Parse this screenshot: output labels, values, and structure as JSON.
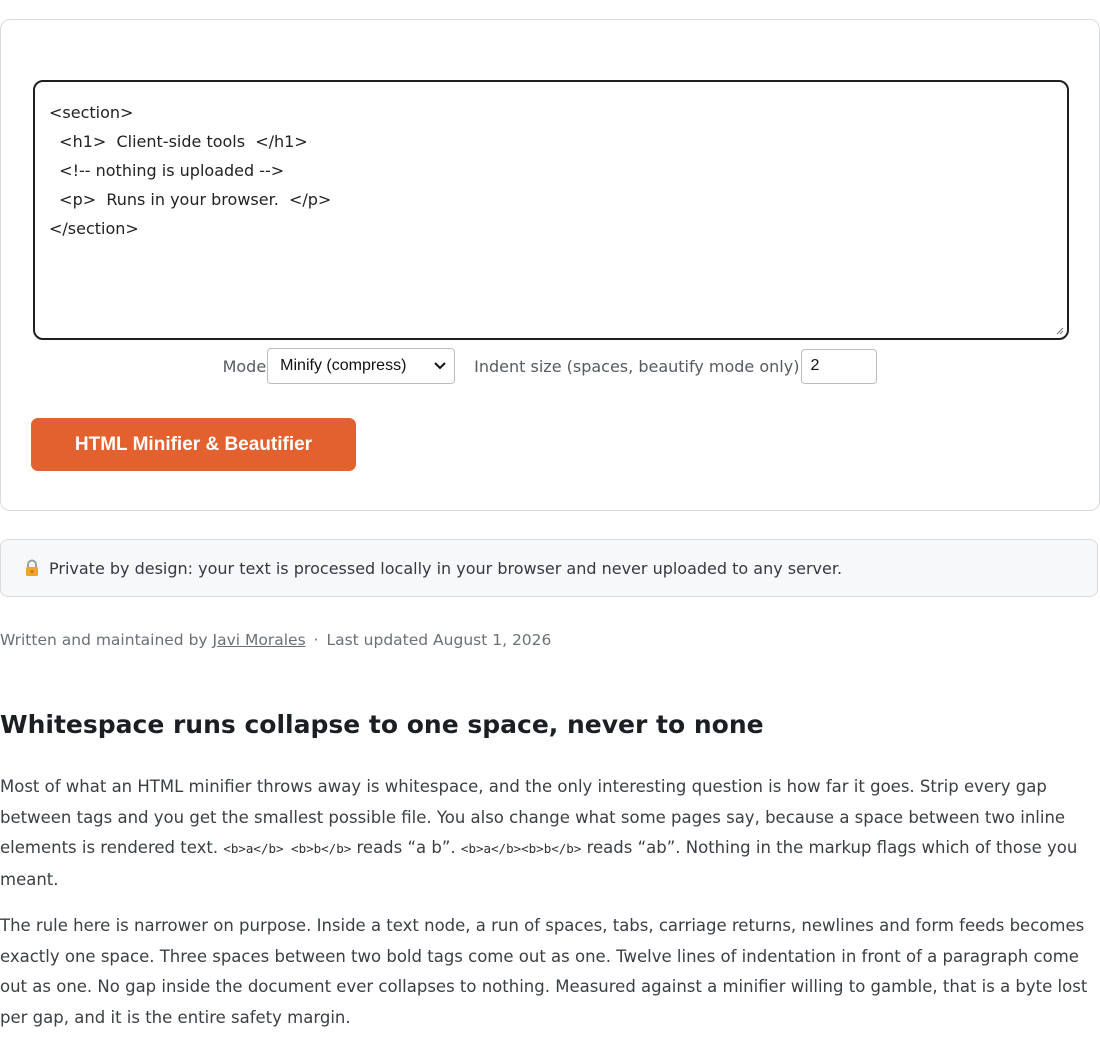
{
  "editor": {
    "lines": [
      "<section>",
      "  <h1>  Client-side tools  </h1>",
      "",
      "  <!-- nothing is uploaded -->",
      "  <p>  Runs in your browser.  </p>",
      "</section>"
    ]
  },
  "controls": {
    "mode_label": "Mode",
    "mode_value": "Minify (compress)",
    "indent_label": "Indent size (spaces, beautify mode only)",
    "indent_value": "2"
  },
  "action_button": "HTML Minifier & Beautifier",
  "notice": {
    "icon": "lock-icon",
    "text": "Private by design: your text is processed locally in your browser and never uploaded to any server."
  },
  "byline": {
    "prefix": "Written and maintained by",
    "author": "Javi Morales",
    "separator": "·",
    "updated": "Last updated August 1, 2026"
  },
  "article": {
    "heading": "Whitespace runs collapse to one space, never to none",
    "p1": {
      "t1": "Most of what an HTML minifier throws away is whitespace, and the only interesting question is how far it goes. Strip every gap between tags and you get the smallest possible file. You also change what some pages say, because a space between two inline elements is rendered text. ",
      "code1": "<b>a</b> <b>b</b>",
      "t2": " reads “a b”. ",
      "code2": "<b>a</b><b>b</b>",
      "t3": " reads “ab”. Nothing in the markup flags which of those you meant."
    },
    "p2": "The rule here is narrower on purpose. Inside a text node, a run of spaces, tabs, carriage returns, newlines and form feeds becomes exactly one space. Three spaces between two bold tags come out as one. Twelve lines of indentation in front of a paragraph come out as one. No gap inside the document ever collapses to nothing. Measured against a minifier willing to gamble, that is a byte lost per gap, and it is the entire safety margin."
  },
  "colors": {
    "accent": "#e3612e",
    "notice_bg": "#f6f8fa"
  }
}
